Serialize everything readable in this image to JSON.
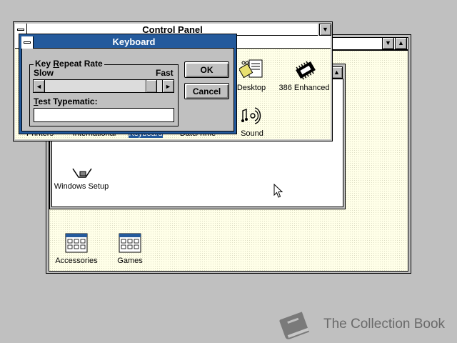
{
  "program_manager": {
    "group_window": {
      "icons": [
        {
          "label": "Windows Setup"
        },
        {
          "label": "Accessories"
        },
        {
          "label": "Games"
        }
      ]
    }
  },
  "control_panel": {
    "title": "Control Panel",
    "icons": [
      {
        "label": "Printers"
      },
      {
        "label": "International"
      },
      {
        "label": "Keyboard"
      },
      {
        "label": "Date/Time"
      },
      {
        "label": "Desktop"
      },
      {
        "label": "386 Enhanced"
      },
      {
        "label": "Sound"
      }
    ]
  },
  "keyboard_dialog": {
    "title": "Keyboard",
    "group_label": "Key Repeat Rate",
    "group_label_pre": "Key ",
    "group_label_mnemonic": "R",
    "group_label_post": "epeat Rate",
    "slow_label": "Slow",
    "fast_label": "Fast",
    "repeat_rate": 0.95,
    "test_label_mnemonic": "T",
    "test_label_rest": "est Typematic:",
    "test_value": "",
    "ok_label": "OK",
    "cancel_label": "Cancel"
  },
  "watermark": {
    "text": "The Collection Book",
    "icon": "book-icon"
  },
  "colors": {
    "title_active": "#245a9c",
    "window_bg": "#ffffe8",
    "desktop": "#c0c0c0"
  }
}
